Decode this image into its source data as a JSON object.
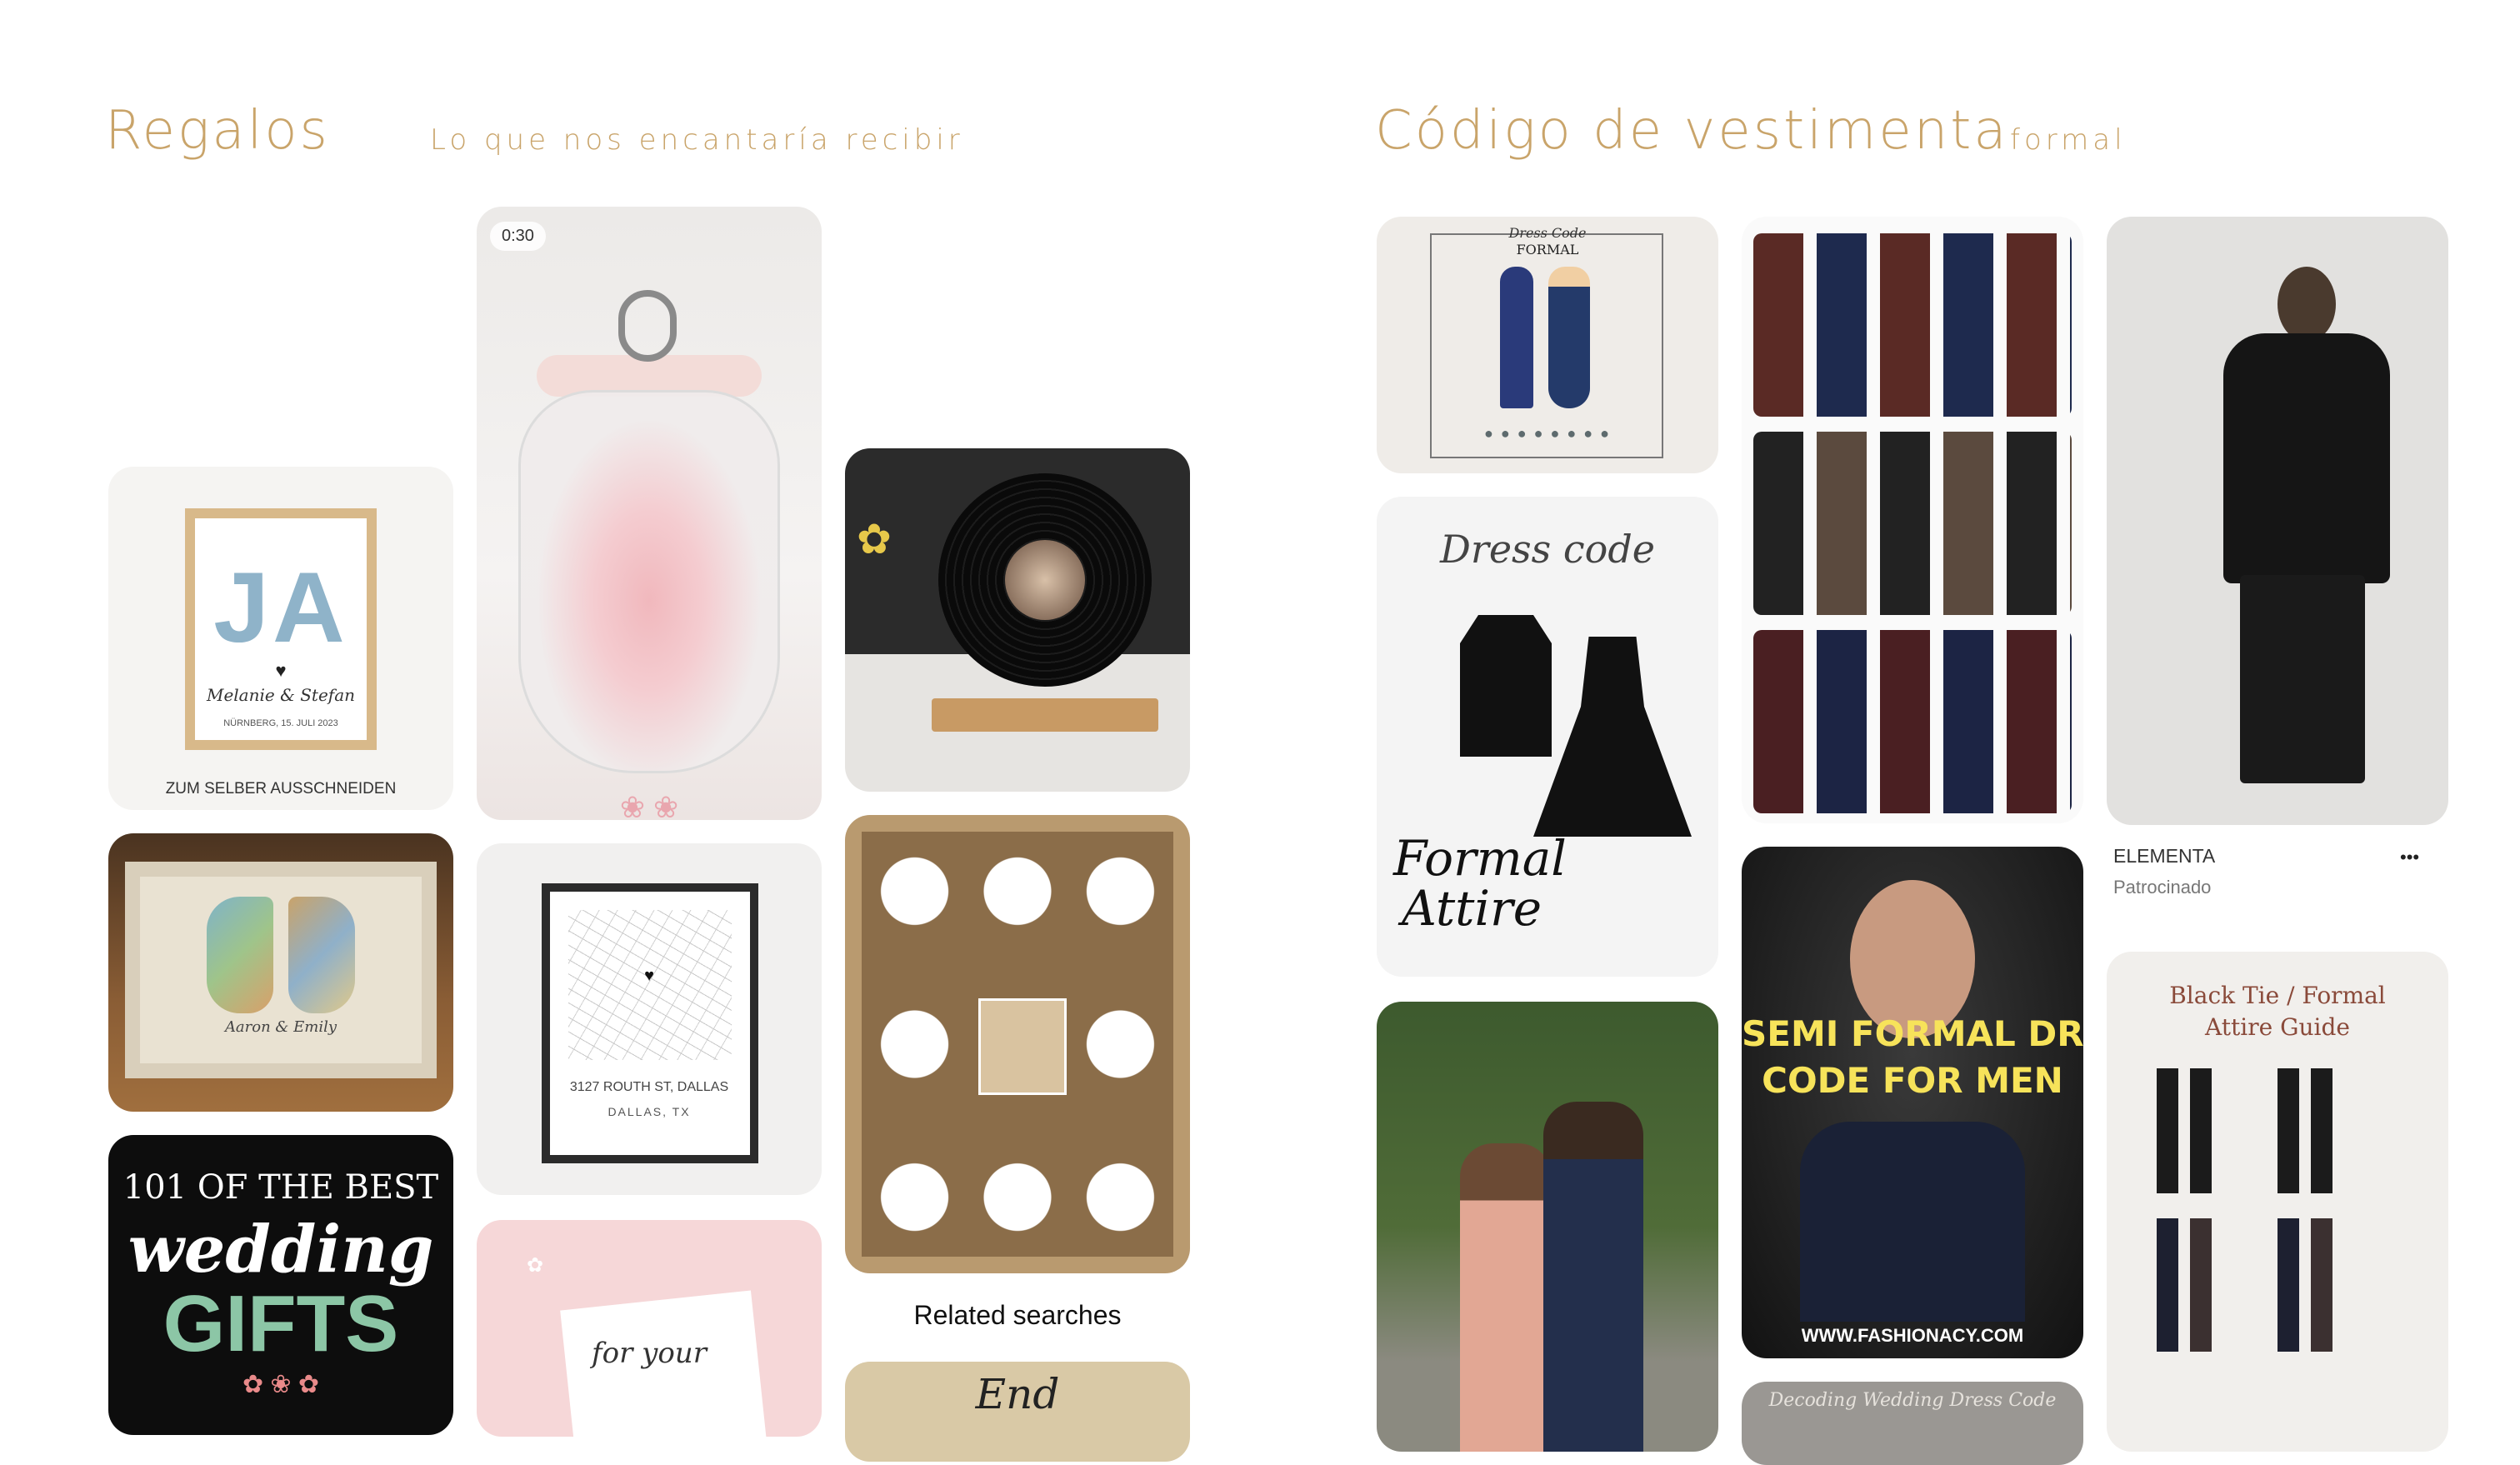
{
  "left": {
    "title": "Regalos",
    "subtitle": "Lo que nos encantaría recibir",
    "pins": {
      "ja_frame": {
        "letters": "JA",
        "names": "Melanie & Stefan",
        "date": "NÜRNBERG, 15. JULI 2023",
        "caption": "ZUM SELBER AUSSCHNEIDEN"
      },
      "silhouette": {
        "names": "Aaron & Emily"
      },
      "wedding_gifts": {
        "line1": "101 OF THE BEST",
        "line2": "wedding",
        "line3": "GIFTS"
      },
      "jar_video": {
        "duration": "0:30"
      },
      "map_print": {
        "street": "3127 ROUTH ST, DALLAS",
        "city": "DALLAS, TX"
      },
      "bottom_card": {
        "script": "for your"
      },
      "vinyl": {},
      "candles": {},
      "related": {
        "label": "Related searches",
        "teaser": "End"
      }
    }
  },
  "right": {
    "title": "Código de vestimenta",
    "subtitle": "formal",
    "pins": {
      "dress_code_chart": {
        "heading": "Dress Code",
        "sub": "FORMAL"
      },
      "formal_attire": {
        "top": "Dress code",
        "bottom1": "Formal",
        "bottom2": "Attire"
      },
      "semi_formal": {
        "line1": "SEMI FORMAL DRESS",
        "line2": "CODE FOR MEN",
        "site": "WWW.FASHIONACY.COM"
      },
      "bottom_teaser": {
        "text": "Decoding Wedding Dress Code"
      },
      "sponsored": {
        "brand": "ELEMENTA",
        "tag": "Patrocinado",
        "more": "•••"
      },
      "black_tie": {
        "line1": "Black Tie / Formal",
        "line2": "Attire Guide"
      },
      "couple_photo": {},
      "suits_grid": {}
    }
  },
  "colors": {
    "heading": "#c9a46a",
    "card_bg": "#f1efec"
  }
}
